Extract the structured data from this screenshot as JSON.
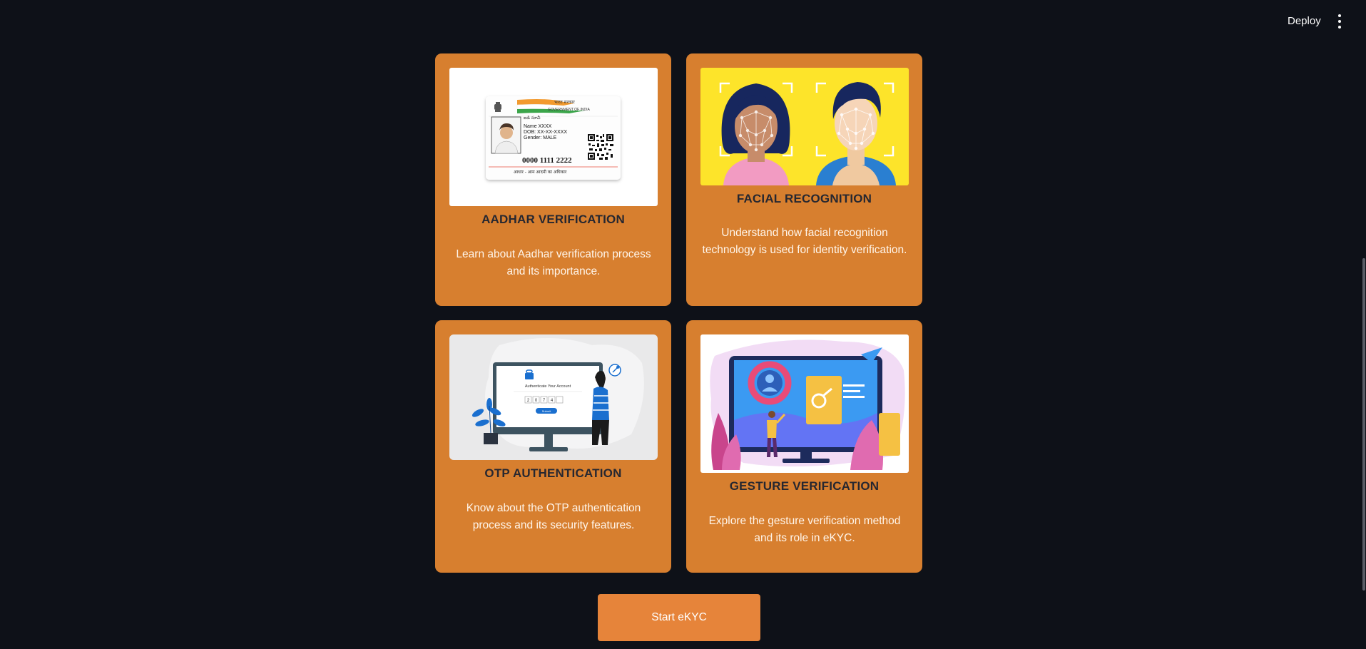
{
  "header": {
    "deploy_label": "Deploy",
    "menu_icon": "more-vertical-icon"
  },
  "cards": [
    {
      "title": "AADHAR VERIFICATION",
      "description": "Learn about Aadhar verification process and its importance.",
      "image": {
        "icon": "aadhar-card-image",
        "gov_text": "भारत सरकार",
        "gov_text_en": "GOVERNMENT OF INDIA",
        "name_line": "Name XXXX",
        "dob_line": "DOB: XX-XX-XXXX",
        "gender_line": "Gender: MALE",
        "number": "0000 1111 2222",
        "slogan": "आधार - आम आदमी का अधिकार"
      }
    },
    {
      "title": "FACIAL RECOGNITION",
      "description": "Understand how facial recognition technology is used for identity verification.",
      "image": {
        "icon": "facial-recognition-image"
      }
    },
    {
      "title": "OTP AUTHENTICATION",
      "description": "Know about the OTP authentication process and its security features.",
      "image": {
        "icon": "otp-authentication-image",
        "screen_title": "Authenticate Your Account",
        "otp_digits": [
          "2",
          "0",
          "7",
          "4",
          ""
        ],
        "submit_label": "Submit"
      }
    },
    {
      "title": "GESTURE VERIFICATION",
      "description": "Explore the gesture verification method and its role in eKYC.",
      "image": {
        "icon": "gesture-verification-image"
      }
    }
  ],
  "start_button": {
    "label": "Start eKYC"
  },
  "colors": {
    "background": "#0e1118",
    "card": "#d77f2f",
    "button": "#e6843a",
    "title_text": "#262730"
  }
}
